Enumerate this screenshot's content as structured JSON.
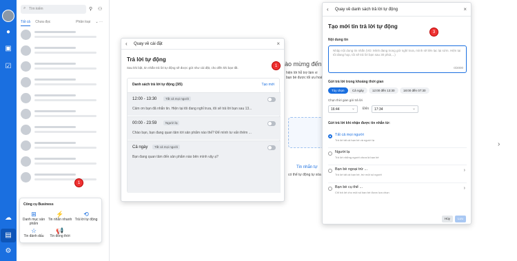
{
  "search": {
    "placeholder": "Tìm kiếm"
  },
  "tabs": {
    "all": "Tất cả",
    "unread": "Chưa đọc",
    "filter": "Phân loại"
  },
  "business_menu": {
    "title": "Công cụ Business",
    "items": [
      {
        "label": "Danh mục sản phẩm",
        "icon": "catalog-icon"
      },
      {
        "label": "Tin nhắn nhanh",
        "icon": "quick-message-icon"
      },
      {
        "label": "Trả lời tự động",
        "icon": "auto-reply-icon"
      },
      {
        "label": "Tin đánh dấu",
        "icon": "star-icon"
      },
      {
        "label": "Tin đồng thời",
        "icon": "broadcast-icon"
      }
    ]
  },
  "badges": {
    "one": "1",
    "three": "3"
  },
  "background": {
    "welcome": "ào mừng đến v",
    "line1": "hiện lời hỗ trợ làm vi",
    "line2": "bạn bè được tối ưu hoá c",
    "promo": "Tin nhắn tự",
    "promo_sub": "có thể tự động tự xóa"
  },
  "dialog1": {
    "back": "Quay về cài đặt",
    "title": "Trả lời tự động",
    "desc": "Sau khi bật, tin nhắn trả lời tự động sẽ được gửi như cài đặt, cho đến khi bạn tắt.",
    "list_title": "Danh sách trả lời tự động (3/5)",
    "new_label": "Tạo mới",
    "items": [
      {
        "time": "12:00 - 13:30",
        "tag": "Tất cả mọi người",
        "msg": "Cảm ơn bạn đã nhắn tin. Hiện tại tôi đang nghỉ trưa, tôi sẽ trả lời bạn sau 13..."
      },
      {
        "time": "00:00 - 23:59",
        "tag": "Người lạ",
        "msg": "Chào bạn, bạn đang quan tâm tới sản phẩm nào thế? Để mình tư vấn thêm ..."
      },
      {
        "time": "Cả ngày",
        "tag": "Tất cả mọi người",
        "msg": "Bạn đang quan tâm đến sản phẩm nào bên mình vậy ạ?"
      }
    ]
  },
  "dialog2": {
    "back": "Quay về danh sách trả lời tự động",
    "title": "Tạo mới tin trả lời tự động",
    "content_label": "Nội dung tin",
    "content_placeholder": "Nhập nội dung tin nhắn (VD: Mình đang trong giờ nghỉ trưa, mình sẽ liên lạc lại sớm. Hiện tại tôi đang họp, tôi sẽ trả lời bạn sau 30 phút,...)",
    "counter": "0/2000",
    "time_label": "Gửi trả lời trong khoảng thời gian",
    "chips": [
      "Tùy chọn",
      "Cả ngày",
      "12:00 đến 13:30",
      "18:00 đến 07:30"
    ],
    "pick_label": "Chọn thời gian gửi trả lời",
    "from": "16:44",
    "to_label": "Đến",
    "to": "17:34",
    "recipient_label": "Gửi trả lời khi nhận được tin nhắn từ:",
    "options": [
      {
        "title": "Tất cả mọi người",
        "desc": "Trả lời tất cả bạn bè và người lạ"
      },
      {
        "title": "Người lạ",
        "desc": "Trả lời những người chưa là bạn bè"
      },
      {
        "title": "Bạn bè ngoại trừ ...",
        "desc": "Trả lời tất cả bạn bè, trừ một số người"
      },
      {
        "title": "Bạn bè cụ thể ...",
        "desc": "Chỉ trả lời cho một số bạn bè được lựa chọn"
      }
    ],
    "cancel": "Hủy",
    "save": "Lưu"
  }
}
